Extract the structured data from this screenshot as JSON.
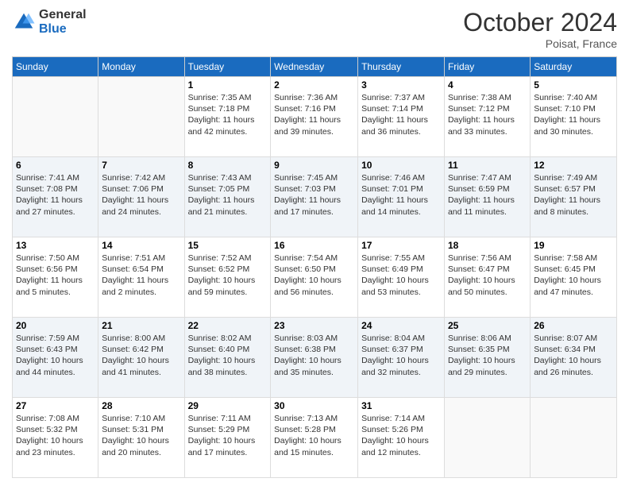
{
  "logo": {
    "general": "General",
    "blue": "Blue"
  },
  "title": "October 2024",
  "location": "Poisat, France",
  "days_header": [
    "Sunday",
    "Monday",
    "Tuesday",
    "Wednesday",
    "Thursday",
    "Friday",
    "Saturday"
  ],
  "weeks": [
    [
      {
        "day": "",
        "info": ""
      },
      {
        "day": "",
        "info": ""
      },
      {
        "day": "1",
        "info": "Sunrise: 7:35 AM\nSunset: 7:18 PM\nDaylight: 11 hours and 42 minutes."
      },
      {
        "day": "2",
        "info": "Sunrise: 7:36 AM\nSunset: 7:16 PM\nDaylight: 11 hours and 39 minutes."
      },
      {
        "day": "3",
        "info": "Sunrise: 7:37 AM\nSunset: 7:14 PM\nDaylight: 11 hours and 36 minutes."
      },
      {
        "day": "4",
        "info": "Sunrise: 7:38 AM\nSunset: 7:12 PM\nDaylight: 11 hours and 33 minutes."
      },
      {
        "day": "5",
        "info": "Sunrise: 7:40 AM\nSunset: 7:10 PM\nDaylight: 11 hours and 30 minutes."
      }
    ],
    [
      {
        "day": "6",
        "info": "Sunrise: 7:41 AM\nSunset: 7:08 PM\nDaylight: 11 hours and 27 minutes."
      },
      {
        "day": "7",
        "info": "Sunrise: 7:42 AM\nSunset: 7:06 PM\nDaylight: 11 hours and 24 minutes."
      },
      {
        "day": "8",
        "info": "Sunrise: 7:43 AM\nSunset: 7:05 PM\nDaylight: 11 hours and 21 minutes."
      },
      {
        "day": "9",
        "info": "Sunrise: 7:45 AM\nSunset: 7:03 PM\nDaylight: 11 hours and 17 minutes."
      },
      {
        "day": "10",
        "info": "Sunrise: 7:46 AM\nSunset: 7:01 PM\nDaylight: 11 hours and 14 minutes."
      },
      {
        "day": "11",
        "info": "Sunrise: 7:47 AM\nSunset: 6:59 PM\nDaylight: 11 hours and 11 minutes."
      },
      {
        "day": "12",
        "info": "Sunrise: 7:49 AM\nSunset: 6:57 PM\nDaylight: 11 hours and 8 minutes."
      }
    ],
    [
      {
        "day": "13",
        "info": "Sunrise: 7:50 AM\nSunset: 6:56 PM\nDaylight: 11 hours and 5 minutes."
      },
      {
        "day": "14",
        "info": "Sunrise: 7:51 AM\nSunset: 6:54 PM\nDaylight: 11 hours and 2 minutes."
      },
      {
        "day": "15",
        "info": "Sunrise: 7:52 AM\nSunset: 6:52 PM\nDaylight: 10 hours and 59 minutes."
      },
      {
        "day": "16",
        "info": "Sunrise: 7:54 AM\nSunset: 6:50 PM\nDaylight: 10 hours and 56 minutes."
      },
      {
        "day": "17",
        "info": "Sunrise: 7:55 AM\nSunset: 6:49 PM\nDaylight: 10 hours and 53 minutes."
      },
      {
        "day": "18",
        "info": "Sunrise: 7:56 AM\nSunset: 6:47 PM\nDaylight: 10 hours and 50 minutes."
      },
      {
        "day": "19",
        "info": "Sunrise: 7:58 AM\nSunset: 6:45 PM\nDaylight: 10 hours and 47 minutes."
      }
    ],
    [
      {
        "day": "20",
        "info": "Sunrise: 7:59 AM\nSunset: 6:43 PM\nDaylight: 10 hours and 44 minutes."
      },
      {
        "day": "21",
        "info": "Sunrise: 8:00 AM\nSunset: 6:42 PM\nDaylight: 10 hours and 41 minutes."
      },
      {
        "day": "22",
        "info": "Sunrise: 8:02 AM\nSunset: 6:40 PM\nDaylight: 10 hours and 38 minutes."
      },
      {
        "day": "23",
        "info": "Sunrise: 8:03 AM\nSunset: 6:38 PM\nDaylight: 10 hours and 35 minutes."
      },
      {
        "day": "24",
        "info": "Sunrise: 8:04 AM\nSunset: 6:37 PM\nDaylight: 10 hours and 32 minutes."
      },
      {
        "day": "25",
        "info": "Sunrise: 8:06 AM\nSunset: 6:35 PM\nDaylight: 10 hours and 29 minutes."
      },
      {
        "day": "26",
        "info": "Sunrise: 8:07 AM\nSunset: 6:34 PM\nDaylight: 10 hours and 26 minutes."
      }
    ],
    [
      {
        "day": "27",
        "info": "Sunrise: 7:08 AM\nSunset: 5:32 PM\nDaylight: 10 hours and 23 minutes."
      },
      {
        "day": "28",
        "info": "Sunrise: 7:10 AM\nSunset: 5:31 PM\nDaylight: 10 hours and 20 minutes."
      },
      {
        "day": "29",
        "info": "Sunrise: 7:11 AM\nSunset: 5:29 PM\nDaylight: 10 hours and 17 minutes."
      },
      {
        "day": "30",
        "info": "Sunrise: 7:13 AM\nSunset: 5:28 PM\nDaylight: 10 hours and 15 minutes."
      },
      {
        "day": "31",
        "info": "Sunrise: 7:14 AM\nSunset: 5:26 PM\nDaylight: 10 hours and 12 minutes."
      },
      {
        "day": "",
        "info": ""
      },
      {
        "day": "",
        "info": ""
      }
    ]
  ]
}
